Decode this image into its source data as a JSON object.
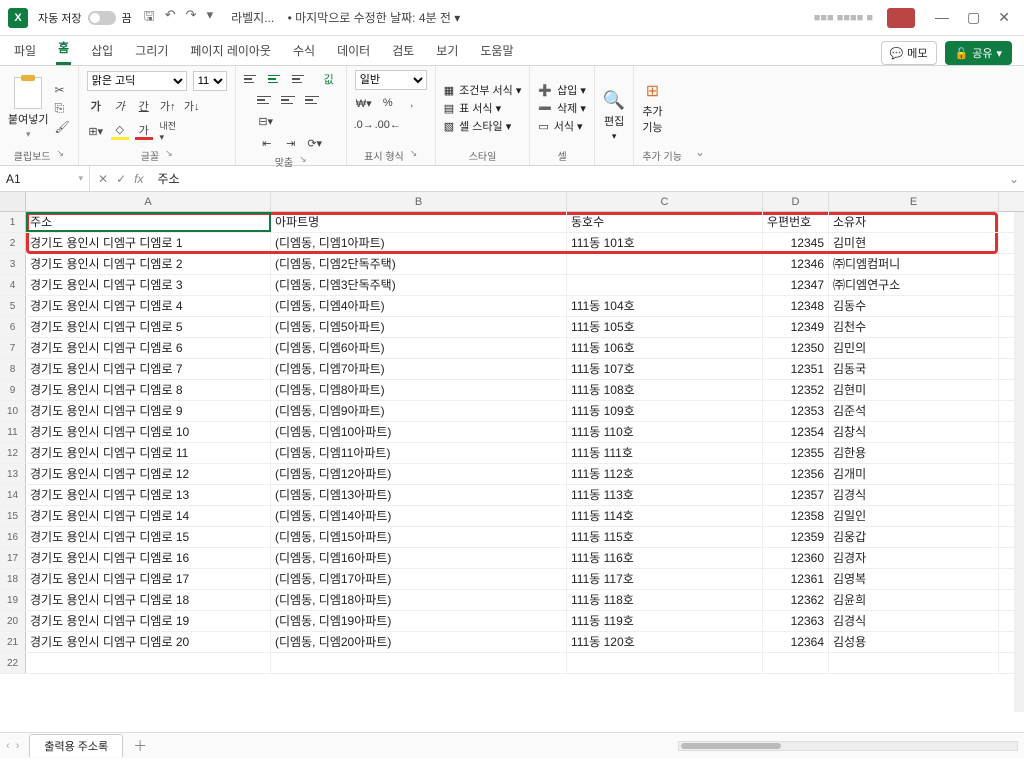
{
  "titlebar": {
    "autosave_label": "자동 저장",
    "autosave_state": "끔",
    "qat_save": "⎘",
    "doc_name": "라벨지...",
    "last_modified": "• 마지막으로 수정한 날짜: 4분 전 ▾",
    "user_name": "■■■ ■■■■ ■"
  },
  "menu": {
    "file": "파일",
    "home": "홈",
    "insert": "삽입",
    "draw": "그리기",
    "page_layout": "페이지 레이아웃",
    "formulas": "수식",
    "data": "데이터",
    "review": "검토",
    "view": "보기",
    "help": "도움말",
    "memo": "메모",
    "share": "공유"
  },
  "ribbon": {
    "clipboard": "클립보드",
    "paste": "붙여넣기",
    "font_group": "글꼴",
    "font_name": "맑은 고딕",
    "font_size": "11",
    "align_group": "맞춤",
    "number_group": "표시 형식",
    "number_format": "일반",
    "styles_group": "스타일",
    "cond_format": "조건부 서식 ▾",
    "table_format": "표 서식 ▾",
    "cell_styles": "셀 스타일 ▾",
    "cells_group": "셀",
    "insert_cmd": "삽입 ▾",
    "delete_cmd": "삭제 ▾",
    "format_cmd": "서식 ▾",
    "editing_group": "편집",
    "editing_label": "편집",
    "addon_group": "추가 기능",
    "addon_label": "추가\n기능"
  },
  "namebox": "A1",
  "formula": "주소",
  "columns": {
    "A": "A",
    "B": "B",
    "C": "C",
    "D": "D",
    "E": "E"
  },
  "headers": {
    "A": "주소",
    "B": "아파트명",
    "C": "동호수",
    "D": "우편번호",
    "E": "소유자"
  },
  "rows": [
    {
      "n": 2,
      "A": "경기도 용인시 디엠구 디엠로 1",
      "B": "(디엠동, 디엠1아파트)",
      "C": "111동 101호",
      "D": "12345",
      "E": "김미현"
    },
    {
      "n": 3,
      "A": "경기도 용인시 디엠구 디엠로 2",
      "B": "(디엠동, 디엠2단독주택)",
      "C": "",
      "D": "12346",
      "E": "㈜디엠컴퍼니"
    },
    {
      "n": 4,
      "A": "경기도 용인시 디엠구 디엠로 3",
      "B": "(디엠동, 디엠3단독주택)",
      "C": "",
      "D": "12347",
      "E": "㈜디엠연구소"
    },
    {
      "n": 5,
      "A": "경기도 용인시 디엠구 디엠로 4",
      "B": "(디엠동, 디엠4아파트)",
      "C": "111동 104호",
      "D": "12348",
      "E": "김동수"
    },
    {
      "n": 6,
      "A": "경기도 용인시 디엠구 디엠로 5",
      "B": "(디엠동, 디엠5아파트)",
      "C": "111동 105호",
      "D": "12349",
      "E": "김천수"
    },
    {
      "n": 7,
      "A": "경기도 용인시 디엠구 디엠로 6",
      "B": "(디엠동, 디엠6아파트)",
      "C": "111동 106호",
      "D": "12350",
      "E": "김민의"
    },
    {
      "n": 8,
      "A": "경기도 용인시 디엠구 디엠로 7",
      "B": "(디엠동, 디엠7아파트)",
      "C": "111동 107호",
      "D": "12351",
      "E": "김동국"
    },
    {
      "n": 9,
      "A": "경기도 용인시 디엠구 디엠로 8",
      "B": "(디엠동, 디엠8아파트)",
      "C": "111동 108호",
      "D": "12352",
      "E": "김현미"
    },
    {
      "n": 10,
      "A": "경기도 용인시 디엠구 디엠로 9",
      "B": "(디엠동, 디엠9아파트)",
      "C": "111동 109호",
      "D": "12353",
      "E": "김준석"
    },
    {
      "n": 11,
      "A": "경기도 용인시 디엠구 디엠로 10",
      "B": "(디엠동, 디엠10아파트)",
      "C": "111동 110호",
      "D": "12354",
      "E": "김창식"
    },
    {
      "n": 12,
      "A": "경기도 용인시 디엠구 디엠로 11",
      "B": "(디엠동, 디엠11아파트)",
      "C": "111동 111호",
      "D": "12355",
      "E": "김한용"
    },
    {
      "n": 13,
      "A": "경기도 용인시 디엠구 디엠로 12",
      "B": "(디엠동, 디엠12아파트)",
      "C": "111동 112호",
      "D": "12356",
      "E": "김개미"
    },
    {
      "n": 14,
      "A": "경기도 용인시 디엠구 디엠로 13",
      "B": "(디엠동, 디엠13아파트)",
      "C": "111동 113호",
      "D": "12357",
      "E": "김경식"
    },
    {
      "n": 15,
      "A": "경기도 용인시 디엠구 디엠로 14",
      "B": "(디엠동, 디엠14아파트)",
      "C": "111동 114호",
      "D": "12358",
      "E": "김일인"
    },
    {
      "n": 16,
      "A": "경기도 용인시 디엠구 디엠로 15",
      "B": "(디엠동, 디엠15아파트)",
      "C": "111동 115호",
      "D": "12359",
      "E": "김웅갑"
    },
    {
      "n": 17,
      "A": "경기도 용인시 디엠구 디엠로 16",
      "B": "(디엠동, 디엠16아파트)",
      "C": "111동 116호",
      "D": "12360",
      "E": "김경자"
    },
    {
      "n": 18,
      "A": "경기도 용인시 디엠구 디엠로 17",
      "B": "(디엠동, 디엠17아파트)",
      "C": "111동 117호",
      "D": "12361",
      "E": "김영복"
    },
    {
      "n": 19,
      "A": "경기도 용인시 디엠구 디엠로 18",
      "B": "(디엠동, 디엠18아파트)",
      "C": "111동 118호",
      "D": "12362",
      "E": "김윤희"
    },
    {
      "n": 20,
      "A": "경기도 용인시 디엠구 디엠로 19",
      "B": "(디엠동, 디엠19아파트)",
      "C": "111동 119호",
      "D": "12363",
      "E": "김경식"
    },
    {
      "n": 21,
      "A": "경기도 용인시 디엠구 디엠로 20",
      "B": "(디엠동, 디엠20아파트)",
      "C": "111동 120호",
      "D": "12364",
      "E": "김성용"
    }
  ],
  "sheet_tab": "출력용 주소록"
}
